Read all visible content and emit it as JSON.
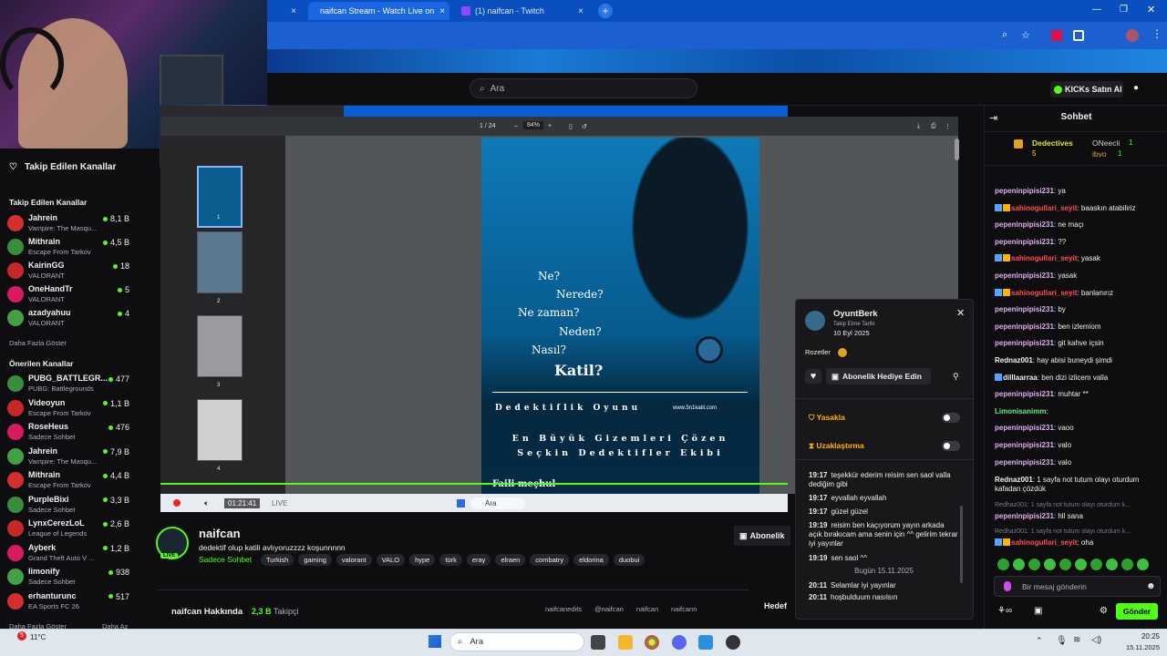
{
  "browser": {
    "tabs": [
      {
        "label": "naifcan Stream - Watch Live on",
        "active": true
      },
      {
        "label": "(1) naifcan - Twitch",
        "active": false
      }
    ],
    "tab_close": "×",
    "new_tab": "+"
  },
  "site": {
    "search_placeholder": "Ara",
    "buy_kicks": "KICKs Satın Al"
  },
  "sidebar": {
    "followed_header": "Takip Edilen Kanallar",
    "followed_section": "Takip Edilen Kanallar",
    "followed": [
      {
        "name": "Jahrein",
        "game": "Vampire: The Masqu...",
        "viewers": "8,1 B"
      },
      {
        "name": "Mithrain",
        "game": "Escape From Tarkov",
        "viewers": "4,5 B"
      },
      {
        "name": "KairinGG",
        "game": "VALORANT",
        "viewers": "18"
      },
      {
        "name": "OneHandTr",
        "game": "VALORANT",
        "viewers": "5"
      },
      {
        "name": "azadyahuu",
        "game": "VALORANT",
        "viewers": "4"
      }
    ],
    "show_more": "Daha Fazla Göster",
    "recommended_section": "Önerilen Kanallar",
    "recommended": [
      {
        "name": "PUBG_BATTLEGR...",
        "game": "PUBG: Battlegrounds",
        "viewers": "477"
      },
      {
        "name": "Videoyun",
        "game": "Escape From Tarkov",
        "viewers": "1,1 B"
      },
      {
        "name": "RoseHeus",
        "game": "Sadece Sohbet",
        "viewers": "476"
      },
      {
        "name": "Jahrein",
        "game": "Vampire: The Masqu...",
        "viewers": "7,9 B"
      },
      {
        "name": "Mithrain",
        "game": "Escape From Tarkov",
        "viewers": "4,4 B"
      },
      {
        "name": "PurpleBixi",
        "game": "Sadece Sohbet",
        "viewers": "3,3 B"
      },
      {
        "name": "LynxCerezLoL",
        "game": "League of Legends",
        "viewers": "2,6 B"
      },
      {
        "name": "Ayberk",
        "game": "Grand Theft Auto V ...",
        "viewers": "1,2 B"
      },
      {
        "name": "limonify",
        "game": "Sadece Sohbet",
        "viewers": "938"
      },
      {
        "name": "erhanturunc",
        "game": "EA Sports FC 26",
        "viewers": "517"
      }
    ],
    "show_more_2": "Daha Fazla Göster",
    "show_less": "Daha Az"
  },
  "pdf": {
    "page_indicator": "1  / 24",
    "zoom": "84%",
    "thumb_labels": [
      "1",
      "2",
      "3",
      "4"
    ],
    "questions": [
      "Ne?",
      "Nerede?",
      "Ne zaman?",
      "Neden?",
      "Nasıl?",
      "Katil?"
    ],
    "game_title": "Dedektiflik Oyunu",
    "site": "www.5n1katil.com",
    "tagline_1": "En Büyük Gizemleri Çözen",
    "tagline_2": "Seçkin Dedektifler Ekibi",
    "footer": "Faili meçhul"
  },
  "player": {
    "time": "01:21:41",
    "live": "LIVE",
    "search": "Ara"
  },
  "stream": {
    "channel": "naifcan",
    "title": "dedektif olup katili avlıyoruzzzz koşunnnnn",
    "category": "Sadece Sohbet",
    "tags": [
      "Turkish",
      "gaming",
      "valorant",
      "VALO",
      "hype",
      "türk",
      "eray",
      "elraen",
      "combatry",
      "eldorina",
      "duobui"
    ],
    "about": "naifcan Hakkında",
    "followers_count": "2,3 B",
    "followers_label": "Takipçi",
    "socials": [
      "naifcanedits",
      "@naifcan",
      "naifcan",
      "naifcann"
    ],
    "subscribe": "Abonelik",
    "hedef": "Hedef"
  },
  "usercard": {
    "username": "OyuntBerk",
    "follow_label": "Takip Etme Tarihi",
    "follow_date": "10 Eyl 2025",
    "badges_label": "Rozetler",
    "gift_button": "Abonelik Hediye Edin",
    "ban_label": "Yasakla",
    "timeout_label": "Uzaklaştırma",
    "history": [
      {
        "time": "19:17",
        "text": "teşekkür ederim reisim sen saol valla dediğim gibi"
      },
      {
        "time": "19:17",
        "text": "eyvallah eyvallah"
      },
      {
        "time": "19:17",
        "text": "güzel güzel"
      },
      {
        "time": "19:19",
        "text": "reisim ben kaçıyorum yayın arkada açık bırakıcam ama senin için ^^ gelirim tekrar iyi yayınlar"
      },
      {
        "time": "19:19",
        "text": "sen saol ^^"
      }
    ],
    "divider": "Bugün 15.11.2025",
    "history_today": [
      {
        "time": "20:11",
        "text": "Selamlar iyi yayınlar"
      },
      {
        "time": "20:11",
        "text": "hoşbulduum nasılsın"
      }
    ]
  },
  "chat": {
    "title": "Sohbet",
    "leaders": [
      {
        "name": "Dedectives",
        "count": "5"
      },
      {
        "name": "ONeecli",
        "count": "1"
      },
      {
        "name": "ibvo",
        "count": "1"
      }
    ],
    "messages": [
      {
        "user": "pepeninpipisi231",
        "text": "ya",
        "cls": "u1",
        "badges": 0
      },
      {
        "user": "sahinogullari_seyit",
        "text": "baaskın atabiliriz",
        "cls": "u2",
        "badges": 2
      },
      {
        "user": "pepeninpipisi231",
        "text": "ne maçı",
        "cls": "u1",
        "badges": 0
      },
      {
        "user": "pepeninpipisi231",
        "text": "??",
        "cls": "u1",
        "badges": 0
      },
      {
        "user": "sahinogullari_seyit",
        "text": "yasak",
        "cls": "u2",
        "badges": 2
      },
      {
        "user": "pepeninpipisi231",
        "text": "yasak",
        "cls": "u1",
        "badges": 0
      },
      {
        "user": "sahinogullari_seyit",
        "text": "banlanırız",
        "cls": "u2",
        "badges": 2
      },
      {
        "user": "pepeninpipisi231",
        "text": "by",
        "cls": "u1",
        "badges": 0
      },
      {
        "user": "pepeninpipisi231",
        "text": "ben izlemiom",
        "cls": "u1",
        "badges": 0
      },
      {
        "user": "pepeninpipisi231",
        "text": "git kahve içsin",
        "cls": "u1",
        "badges": 0
      },
      {
        "user": "Rednaz001",
        "text": "hay abisi buneydi şimdi",
        "cls": "u3",
        "badges": 0
      },
      {
        "user": "dilllaarraa",
        "text": "ben dizi izlicem valla",
        "cls": "u3",
        "badges": 1
      },
      {
        "user": "pepeninpipisi231",
        "text": "muhtar **",
        "cls": "u1",
        "badges": 0
      },
      {
        "user": "Limonisanimm",
        "text": "",
        "cls": "u4",
        "badges": 0
      },
      {
        "user": "pepeninpipisi231",
        "text": "vaoo",
        "cls": "u1",
        "badges": 0
      },
      {
        "user": "pepeninpipisi231",
        "text": "valo",
        "cls": "u1",
        "badges": 0
      },
      {
        "user": "pepeninpipisi231",
        "text": "valo",
        "cls": "u1",
        "badges": 0
      }
    ],
    "long_msg_user": "Rednaz001",
    "long_msg_text": "1 sayfa not tutum olayı oturdum kafadan çözdük",
    "reply_1": "Redhaz001: 1 sayfa not tutum olayı oturdum k...",
    "after_reply_user": "pepeninpipisi231",
    "after_reply_text": "hll sana",
    "reply_2": "Redhaz001: 1 sayfa not tutum olayı oturdum k...",
    "last_user": "sahinogullari_seyit",
    "last_text": "oha",
    "input_placeholder": "Bir mesaj gönderin",
    "send": "Gönder"
  },
  "taskbar": {
    "weather": "11°C",
    "search": "Ara",
    "time": "20:25",
    "date": "15.11.2025"
  }
}
